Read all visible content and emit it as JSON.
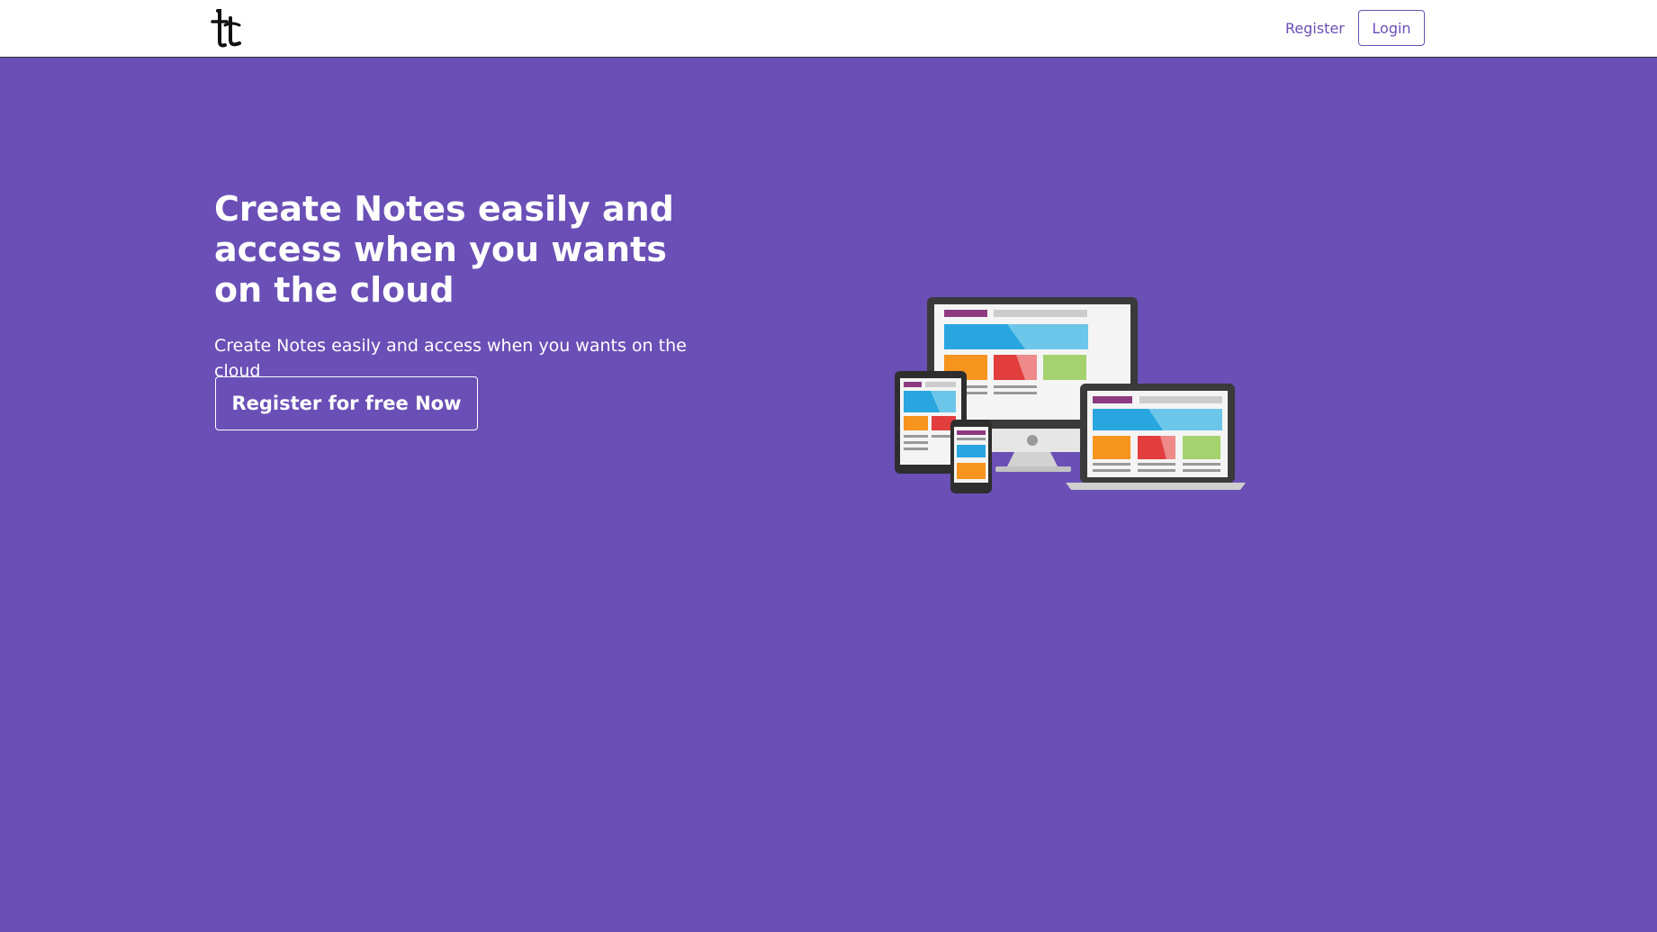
{
  "navbar": {
    "logo_icon": "brand-logo-icon",
    "register_label": "Register",
    "login_label": "Login"
  },
  "hero": {
    "title": "Create Notes easily and access when you wants on the cloud",
    "subtitle": "Create Notes easily and access when you wants on the cloud",
    "cta_label": "Register for free Now",
    "illustration_icon": "responsive-devices-illustration"
  },
  "colors": {
    "primary": "#6a4fb6",
    "white": "#ffffff",
    "device_blue": "#29a6e0",
    "device_orange": "#f7941d",
    "device_red": "#e23e3e",
    "device_green": "#a3d26f"
  }
}
